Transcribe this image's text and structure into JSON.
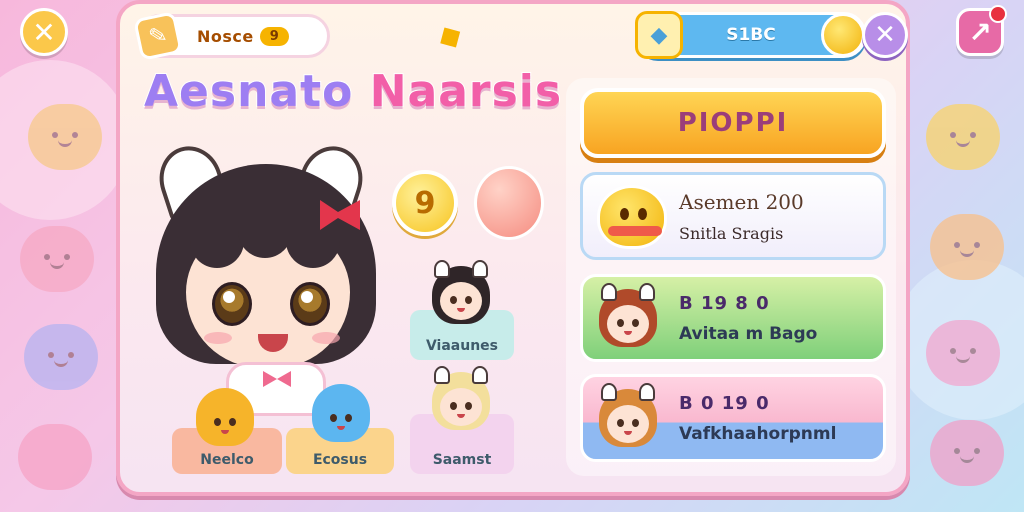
{
  "left_corner": {
    "icon": "close-icon"
  },
  "right_corner": {
    "icon": "exit-icon"
  },
  "header": {
    "tag_label": "Nosce",
    "tag_value": "9",
    "currency_value": "S1BC",
    "currency_icon": "gem-icon",
    "coin_icon": "coin-icon",
    "close_icon": "close-icon"
  },
  "title": {
    "words": [
      {
        "text": "Aesnato",
        "color": "#9d7ef2"
      },
      {
        "text": " ",
        "color": "#ffffff"
      },
      {
        "text": "Naarsis",
        "color": "#f25fa8"
      }
    ]
  },
  "hero": {
    "badge": "9"
  },
  "characters": [
    {
      "label": "Viaaunes",
      "hair": "#2f2528"
    },
    {
      "label": "Neelco",
      "hair": "#f6b42a"
    },
    {
      "label": "Ecosus",
      "hair": "#5cb6f0"
    },
    {
      "label": "Saamst",
      "hair": "#f3df9c"
    }
  ],
  "play_button": {
    "label": "PIOPPI"
  },
  "cards": [
    {
      "line1": "Asemen 200",
      "line2": "Snitla Sragis"
    },
    {
      "line1": "B 19 8 0",
      "line2": "Avitaa m Bago"
    },
    {
      "line1": "B 0 19 0",
      "line2": "Vafkhaahorpnml"
    }
  ],
  "colors": {
    "panel_border": "#f4a6c5",
    "play_button": "#f8a422",
    "currency_bar": "#5eb8f0",
    "accent_purple": "#b88ee8"
  }
}
